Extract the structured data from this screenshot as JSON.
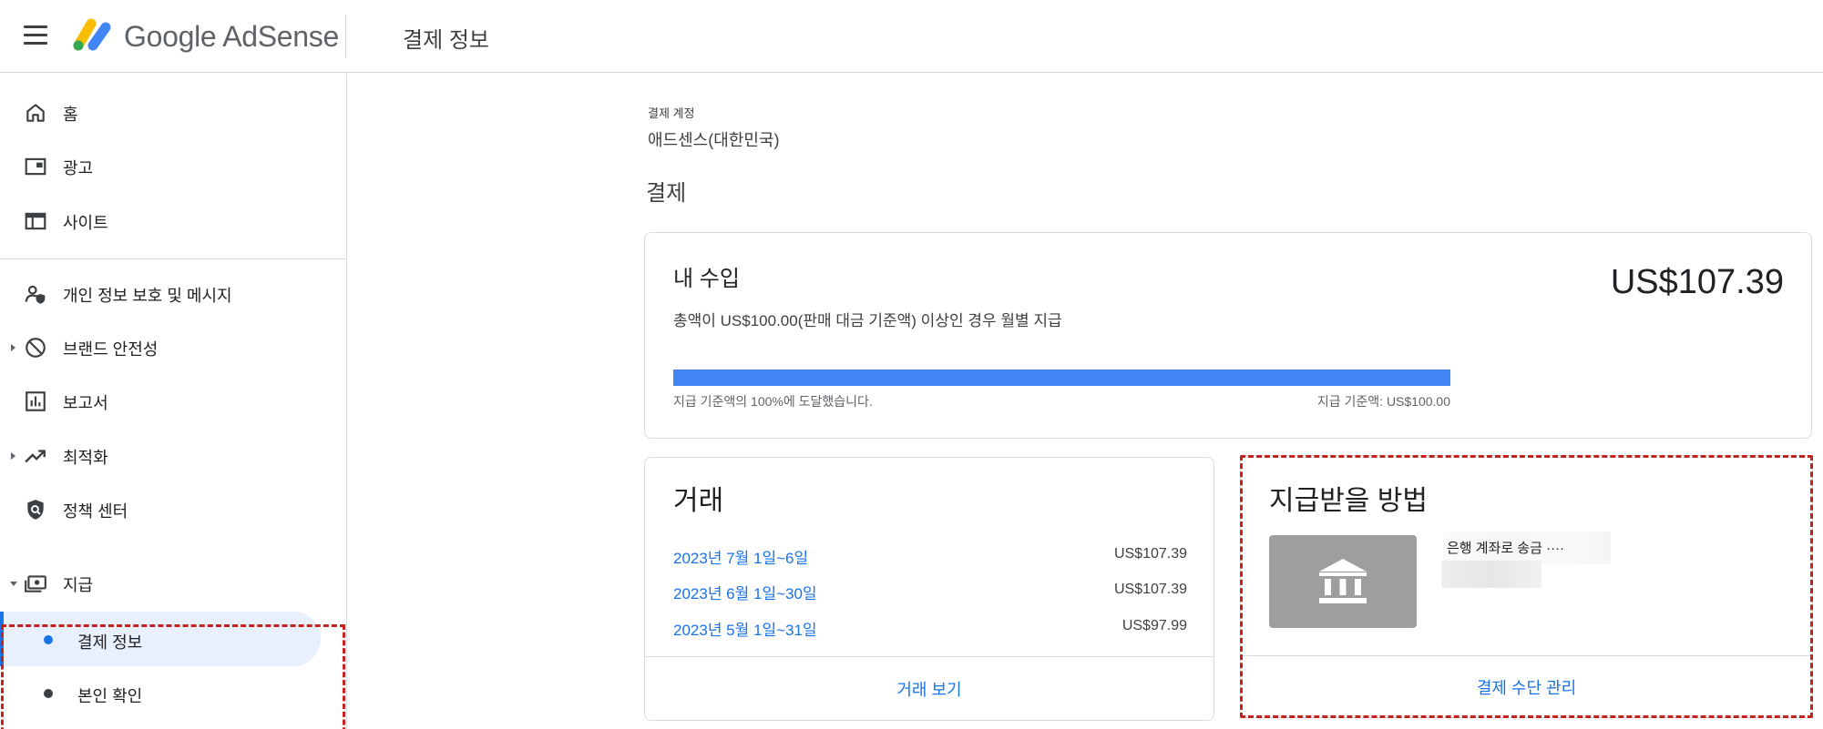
{
  "header": {
    "brand": "Google AdSense",
    "page_title": "결제 정보"
  },
  "sidebar": {
    "items": [
      {
        "label": "홈",
        "icon": "home-icon"
      },
      {
        "label": "광고",
        "icon": "ads-icon"
      },
      {
        "label": "사이트",
        "icon": "sites-icon"
      },
      {
        "label": "개인 정보 보호 및 메시지",
        "icon": "privacy-icon"
      },
      {
        "label": "브랜드 안전성",
        "icon": "block-icon"
      },
      {
        "label": "보고서",
        "icon": "reports-icon"
      },
      {
        "label": "최적화",
        "icon": "trending-up-icon"
      },
      {
        "label": "정책 센터",
        "icon": "policy-shield-icon"
      },
      {
        "label": "지급",
        "icon": "payments-icon"
      }
    ],
    "payment_sub": [
      {
        "label": "결제 정보",
        "active": true
      },
      {
        "label": "본인 확인",
        "active": false
      }
    ]
  },
  "main": {
    "account_label": "결제 계정",
    "account_value": "애드센스(대한민국)",
    "section_title": "결제",
    "earnings": {
      "title": "내 수입",
      "amount": "US$107.39",
      "description": "총액이 US$100.00(판매 대금 기준액) 이상인 경우 월별 지급",
      "progress_percent": 100,
      "progress_left": "지급 기준액의 100%에 도달했습니다.",
      "progress_right": "지급 기준액: US$100.00"
    },
    "transactions": {
      "title": "거래",
      "rows": [
        {
          "date": "2023년 7월 1일~6일",
          "amount": "US$107.39"
        },
        {
          "date": "2023년 6월 1일~30일",
          "amount": "US$107.39"
        },
        {
          "date": "2023년 5월 1일~31일",
          "amount": "US$97.99"
        }
      ],
      "link": "거래 보기"
    },
    "payout": {
      "title": "지급받을 방법",
      "method": "은행 계좌로 송금 ····",
      "link": "결제 수단 관리"
    }
  },
  "colors": {
    "accent": "#1a73e8",
    "progress": "#4285f4",
    "highlight": "#c5221f"
  }
}
